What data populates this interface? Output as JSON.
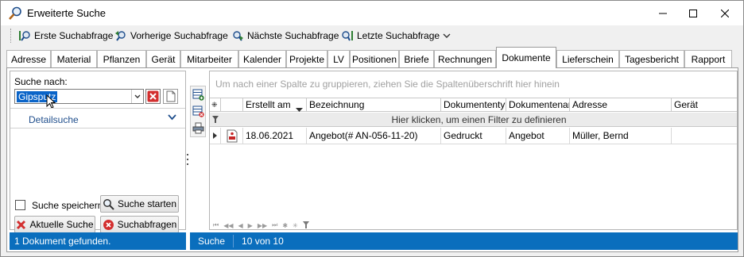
{
  "window": {
    "title": "Erweiterte Suche"
  },
  "toolbar": {
    "first": "Erste Suchabfrage",
    "previous": "Vorherige Suchabfrage",
    "next": "Nächste Suchabfrage",
    "last": "Letzte Suchabfrage"
  },
  "tabs": [
    "Adresse",
    "Material",
    "Pflanzen",
    "Gerät",
    "Mitarbeiter",
    "Kalender",
    "Projekte",
    "LV",
    "Positionen",
    "Briefe",
    "Rechnungen",
    "Dokumente",
    "Lieferschein",
    "Tagesbericht",
    "Rapport"
  ],
  "active_tab": "Dokumente",
  "search": {
    "label": "Suche nach:",
    "value": "Gipsputz",
    "detail_label": "Detailsuche",
    "save_label": "Suche speichern",
    "start_label": "Suche starten",
    "current_label": "Aktuelle Suche",
    "queries_label": "Suchabfragen"
  },
  "status": {
    "left": "1 Dokument gefunden.",
    "mode": "Suche",
    "count": "10 von 10"
  },
  "grid": {
    "group_hint": "Um nach einer Spalte zu gruppieren, ziehen Sie die Spaltenüberschrift hier hinein",
    "filter_hint": "Hier klicken, um einen Filter zu definieren",
    "columns": [
      "Erstellt am",
      "Bezeichnung",
      "Dokumententyp",
      "Dokumentenart",
      "Adresse",
      "Gerät"
    ],
    "rows": [
      {
        "created": "18.06.2021",
        "name": "Angebot(# AN-056-11-20)",
        "type": "Gedruckt",
        "kind": "Angebot",
        "address": "Müller, Bernd",
        "device": ""
      }
    ]
  }
}
